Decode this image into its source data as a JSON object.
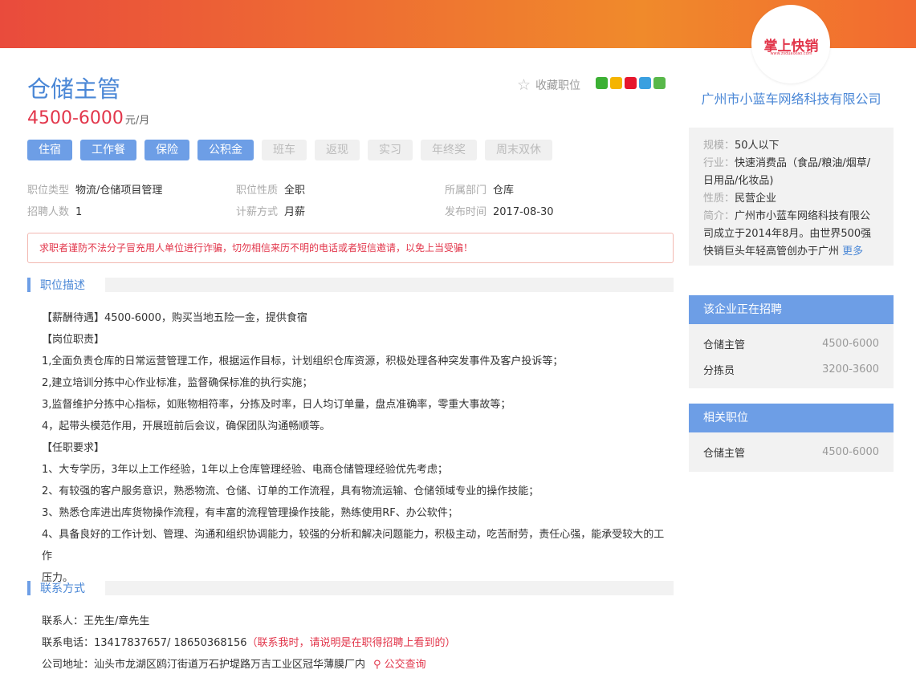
{
  "brand": {
    "logo_text": "掌上快销",
    "logo_sub": "www.zsduaixiao.com"
  },
  "job": {
    "title": "仓储主管",
    "salary": "4500-6000",
    "salary_unit": "元/月",
    "favorite_label": "收藏职位",
    "tags_on": [
      "住宿",
      "工作餐",
      "保险",
      "公积金"
    ],
    "tags_off": [
      "班车",
      "返现",
      "实习",
      "年终奖",
      "周末双休"
    ],
    "info": {
      "type_k": "职位类型",
      "type_v": "物流/仓储项目管理",
      "nature_k": "职位性质",
      "nature_v": "全职",
      "dept_k": "所属部门",
      "dept_v": "仓库",
      "count_k": "招聘人数",
      "count_v": "1",
      "pay_k": "计薪方式",
      "pay_v": "月薪",
      "date_k": "发布时间",
      "date_v": "2017-08-30"
    },
    "warning": "求职者谨防不法分子冒充用人单位进行诈骗，切勿相信来历不明的电话或者短信邀请，以免上当受骗！"
  },
  "desc_section": {
    "title": "职位描述"
  },
  "desc_lines": [
    "【薪酬待遇】4500-6000，购买当地五险一金，提供食宿",
    "【岗位职责】",
    "1,全面负责仓库的日常运营管理工作，根据运作目标，计划组织仓库资源，积极处理各种突发事件及客户投诉等；",
    "2,建立培训分拣中心作业标准，监督确保标准的执行实施；",
    "3,监督维护分拣中心指标，如账物相符率，分拣及时率，日人均订单量，盘点准确率，零重大事故等；",
    "4，起带头模范作用，开展班前后会议，确保团队沟通畅顺等。",
    "【任职要求】",
    "1、大专学历，3年以上工作经验，1年以上仓库管理经验、电商仓储管理经验优先考虑；",
    "2、有较强的客户服务意识，熟悉物流、仓储、订单的工作流程，具有物流运输、仓储领域专业的操作技能；",
    "3、熟悉仓库进出库货物操作流程，有丰富的流程管理操作技能，熟练使用RF、办公软件；",
    "4、具备良好的工作计划、管理、沟通和组织协调能力，较强的分析和解决问题能力，积极主动，吃苦耐劳，责任心强，能承受较大的工作",
    "压力。"
  ],
  "contact_section": {
    "title": "联系方式"
  },
  "contact": {
    "person_label": "联系人：",
    "person": "王先生/章先生",
    "phone_label": "联系电话：",
    "phone": "13417837657/ 18650368156",
    "phone_note": "（联系我时，请说明是在职得招聘上看到的）",
    "address_label": "公司地址：",
    "address": "汕头市龙湖区鸥汀街道万石护堤路万吉工业区冠华薄膜厂内",
    "transit": "公交查询"
  },
  "company": {
    "name": "广州市小蓝车网络科技有限公司",
    "scale_k": "规模：",
    "scale_v": "50人以下",
    "industry_k": "行业：",
    "industry_v": "快速消费品（食品/粮油/烟草/日用品/化妆品)",
    "nature_k": "性质：",
    "nature_v": "民营企业",
    "intro_k": "简介：",
    "intro_v": "广州市小蓝车网络科技有限公司成立于2014年8月。由世界500强快销巨头年轻高管创办于广州",
    "more": "更多"
  },
  "hiring": {
    "title": "该企业正在招聘",
    "items": [
      {
        "name": "仓储主管",
        "salary": "4500-6000"
      },
      {
        "name": "分拣员",
        "salary": "3200-3600"
      }
    ]
  },
  "related": {
    "title": "相关职位",
    "items": [
      {
        "name": "仓储主管",
        "salary": "4500-6000"
      }
    ]
  },
  "colors": {
    "accent": "#4a87d6",
    "tag": "#6d9ee6",
    "salary": "#e2364b"
  },
  "icons": [
    "star-icon",
    "wechat-icon",
    "qzone-icon",
    "weibo-icon",
    "tencent-weibo-icon",
    "more-share-icon",
    "location-pin-icon"
  ]
}
